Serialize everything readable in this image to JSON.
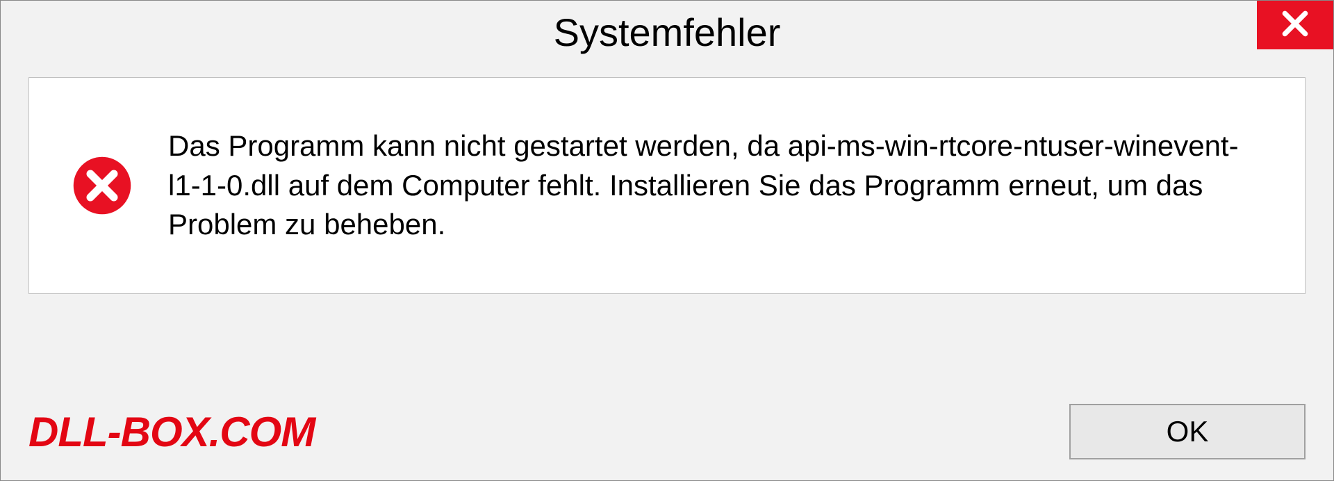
{
  "dialog": {
    "title": "Systemfehler",
    "message": "Das Programm kann nicht gestartet werden, da api-ms-win-rtcore-ntuser-winevent-l1-1-0.dll auf dem Computer fehlt. Installieren Sie das Programm erneut, um das Problem zu beheben.",
    "ok_label": "OK"
  },
  "watermark": "DLL-BOX.COM"
}
